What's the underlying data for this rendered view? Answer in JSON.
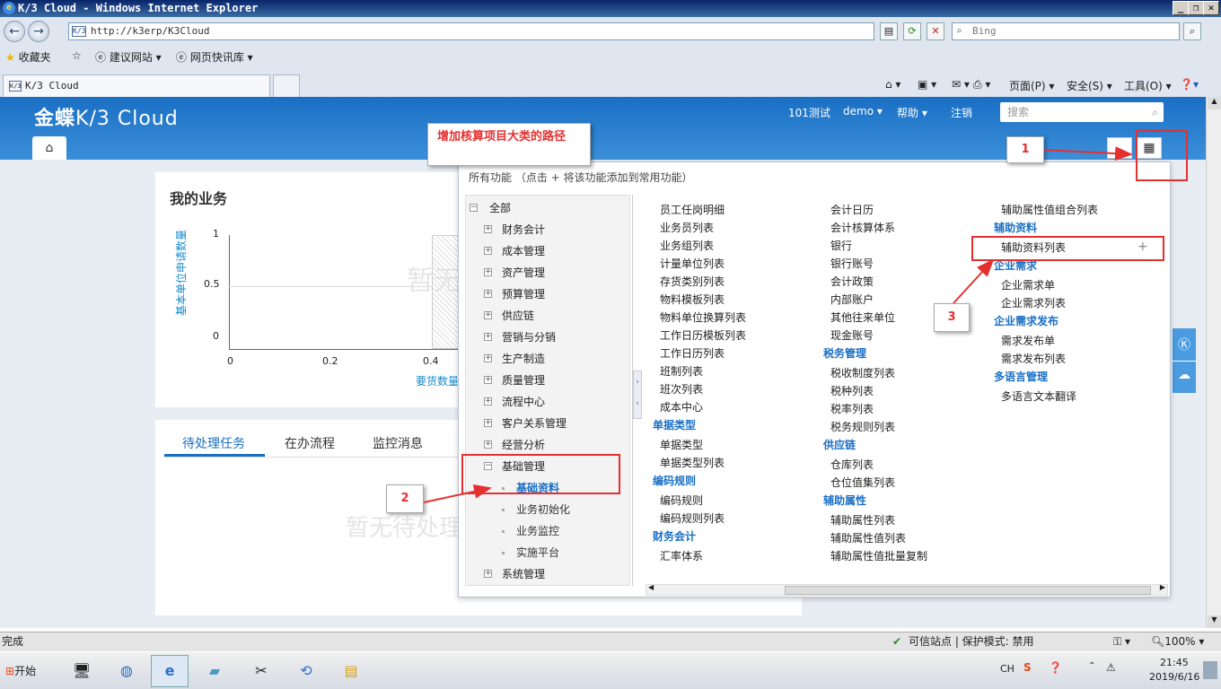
{
  "window": {
    "title": "K/3 Cloud - Windows Internet Explorer"
  },
  "browser": {
    "url": "http://k3erp/K3Cloud",
    "search_placeholder": "Bing",
    "favorites": [
      "收藏夹",
      "建议网站 ▾",
      "网页快讯库 ▾"
    ],
    "tab_label": "K/3 Cloud",
    "commands": [
      "页面(P) ▾",
      "安全(S) ▾",
      "工具(O) ▾"
    ]
  },
  "app": {
    "logo_main": "金蝶",
    "logo_sub": "K/3 Cloud",
    "header_links": [
      "101测试",
      "demo ▾",
      "帮助 ▾",
      "注销"
    ],
    "search_placeholder": "搜索"
  },
  "business_card": {
    "title": "我的业务",
    "watermark": "暂无",
    "yaxis_label": "基本单位申请数量",
    "y_ticks": [
      "1",
      "0.5",
      "0"
    ],
    "x_ticks": [
      "0",
      "0.2",
      "0.4"
    ],
    "xaxis_label": "要货数量"
  },
  "tasks_card": {
    "tabs": [
      "待处理任务",
      "在办流程",
      "监控消息"
    ],
    "empty_text": "暂无待处理"
  },
  "menu": {
    "hint": "所有功能  （点击 + 将该功能添加到常用功能）",
    "tree_root": "全部",
    "tree_items": [
      "财务会计",
      "成本管理",
      "资产管理",
      "预算管理",
      "供应链",
      "营销与分销",
      "生产制造",
      "质量管理",
      "流程中心",
      "客户关系管理",
      "经营分析"
    ],
    "expanded": "基础管理",
    "sub_items": [
      "基础资料",
      "业务初始化",
      "业务监控",
      "实施平台"
    ],
    "last_item": "系统管理",
    "col1": [
      {
        "t": "员工任岗明细",
        "h": false
      },
      {
        "t": "业务员列表",
        "h": false
      },
      {
        "t": "业务组列表",
        "h": false
      },
      {
        "t": "计量单位列表",
        "h": false
      },
      {
        "t": "存货类别列表",
        "h": false
      },
      {
        "t": "物料模板列表",
        "h": false
      },
      {
        "t": "物料单位换算列表",
        "h": false
      },
      {
        "t": "工作日历模板列表",
        "h": false
      },
      {
        "t": "工作日历列表",
        "h": false
      },
      {
        "t": "班制列表",
        "h": false
      },
      {
        "t": "班次列表",
        "h": false
      },
      {
        "t": "成本中心",
        "h": false
      },
      {
        "t": "单据类型",
        "h": true
      },
      {
        "t": "单据类型",
        "h": false
      },
      {
        "t": "单据类型列表",
        "h": false
      },
      {
        "t": "编码规则",
        "h": true
      },
      {
        "t": "编码规则",
        "h": false
      },
      {
        "t": "编码规则列表",
        "h": false
      },
      {
        "t": "财务会计",
        "h": true
      },
      {
        "t": "汇率体系",
        "h": false
      }
    ],
    "col2": [
      {
        "t": "会计日历",
        "h": false
      },
      {
        "t": "会计核算体系",
        "h": false
      },
      {
        "t": "银行",
        "h": false
      },
      {
        "t": "银行账号",
        "h": false
      },
      {
        "t": "会计政策",
        "h": false
      },
      {
        "t": "内部账户",
        "h": false
      },
      {
        "t": "其他往来单位",
        "h": false
      },
      {
        "t": "现金账号",
        "h": false
      },
      {
        "t": "税务管理",
        "h": true
      },
      {
        "t": "税收制度列表",
        "h": false
      },
      {
        "t": "税种列表",
        "h": false
      },
      {
        "t": "税率列表",
        "h": false
      },
      {
        "t": "税务规则列表",
        "h": false
      },
      {
        "t": "供应链",
        "h": true
      },
      {
        "t": "仓库列表",
        "h": false
      },
      {
        "t": "仓位值集列表",
        "h": false
      },
      {
        "t": "辅助属性",
        "h": true
      },
      {
        "t": "辅助属性列表",
        "h": false
      },
      {
        "t": "辅助属性值列表",
        "h": false
      },
      {
        "t": "辅助属性值批量复制",
        "h": false
      }
    ],
    "col3": [
      {
        "t": "辅助属性值组合列表",
        "h": false
      },
      {
        "t": "辅助资料",
        "h": true
      },
      {
        "t": "辅助资料列表",
        "h": false
      },
      {
        "t": "企业需求",
        "h": true
      },
      {
        "t": "企业需求单",
        "h": false
      },
      {
        "t": "企业需求列表",
        "h": false
      },
      {
        "t": "企业需求发布",
        "h": true
      },
      {
        "t": "需求发布单",
        "h": false
      },
      {
        "t": "需求发布列表",
        "h": false
      },
      {
        "t": "多语言管理",
        "h": true
      },
      {
        "t": "多语言文本翻译",
        "h": false
      }
    ]
  },
  "annotations": {
    "path_note": "增加核算项目大类的路径",
    "step1": "1",
    "step2": "2",
    "step3": "3"
  },
  "status": {
    "left": "完成",
    "zone": "可信站点 | 保护模式: 禁用",
    "zoom": "100%"
  },
  "taskbar": {
    "start": "开始",
    "lang": "CH",
    "time": "21:45",
    "date": "2019/6/16"
  }
}
